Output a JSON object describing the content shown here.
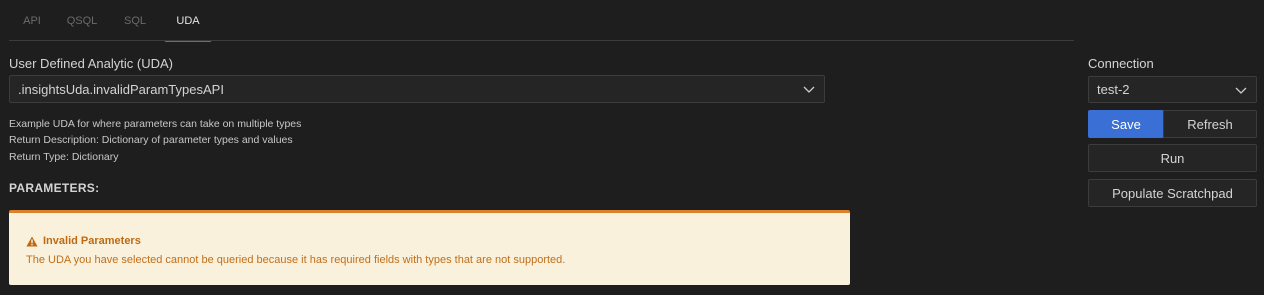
{
  "tabs": [
    {
      "label": "API",
      "active": false
    },
    {
      "label": "QSQL",
      "active": false
    },
    {
      "label": "SQL",
      "active": false
    },
    {
      "label": "UDA",
      "active": true
    }
  ],
  "uda": {
    "label": "User Defined Analytic (UDA)",
    "selected": ".insightsUda.invalidParamTypesAPI",
    "description_lines": [
      "Example UDA for where parameters can take on multiple types",
      "Return Description: Dictionary of parameter types and values",
      "Return Type: Dictionary"
    ]
  },
  "parameters": {
    "title": "PARAMETERS:"
  },
  "warning": {
    "icon": "warning-triangle-icon",
    "title": "Invalid Parameters",
    "message": "The UDA you have selected cannot be queried because it has required fields with types that are not supported."
  },
  "connection": {
    "label": "Connection",
    "selected": "test-2"
  },
  "buttons": {
    "save": "Save",
    "refresh": "Refresh",
    "run": "Run",
    "populate": "Populate Scratchpad"
  },
  "colors": {
    "background": "#1e1e1e",
    "accent": "#3a6fd6",
    "warning_border": "#d9822b",
    "warning_bg": "#f9f1dc",
    "warning_text": "#c26f1a"
  }
}
